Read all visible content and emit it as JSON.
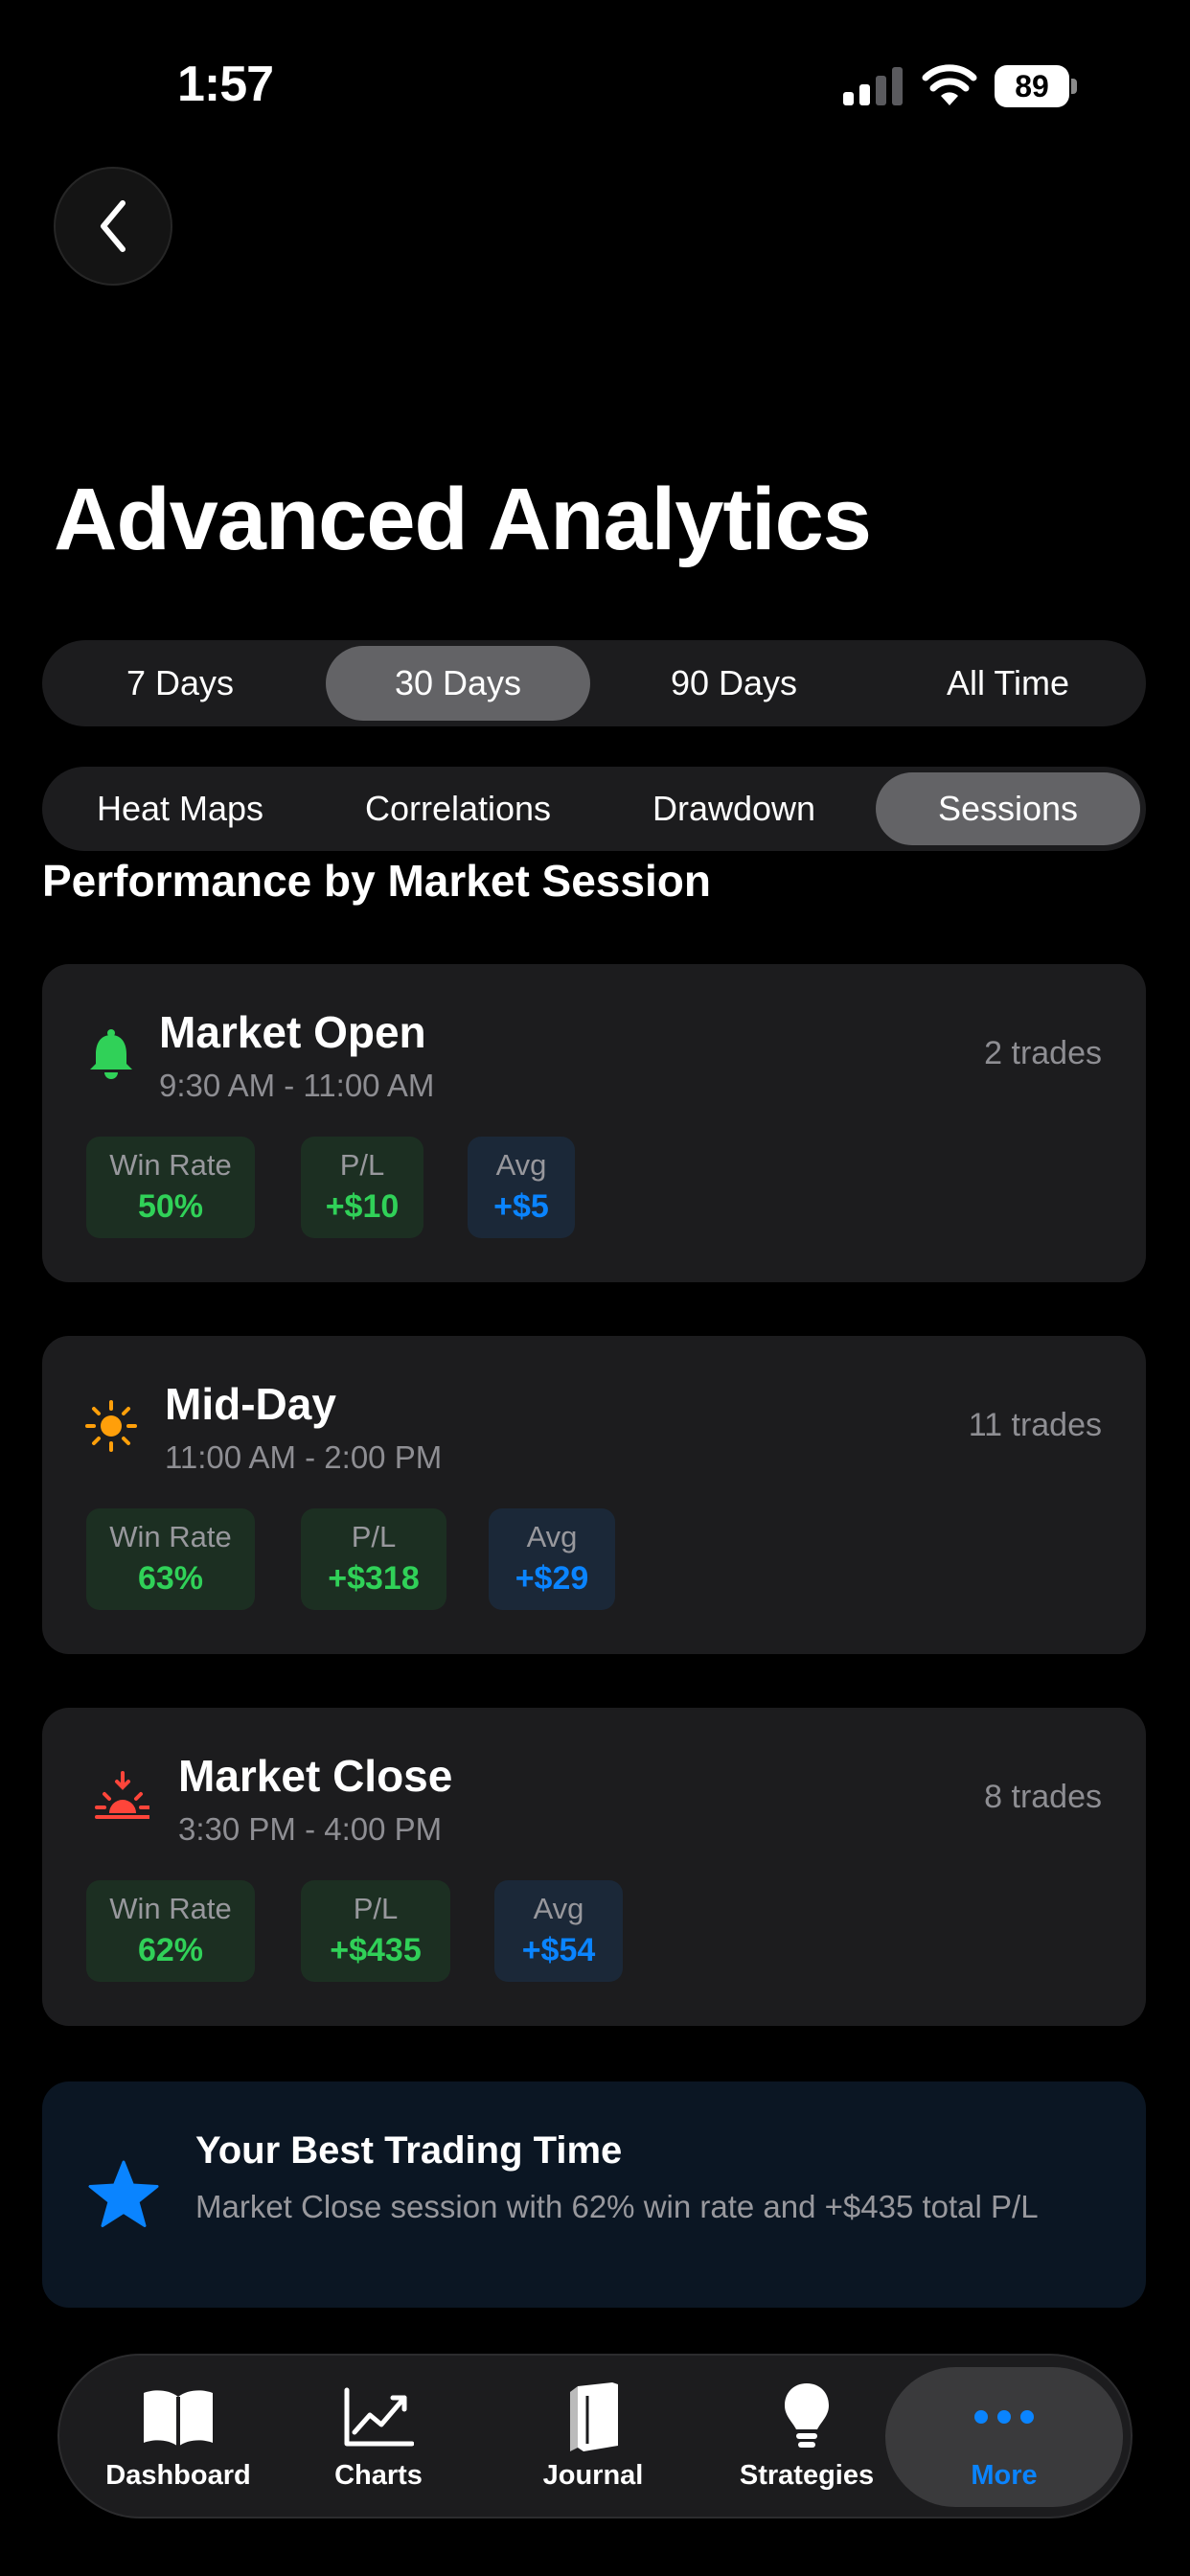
{
  "status": {
    "time": "1:57",
    "battery": "89"
  },
  "header": {
    "title": "Advanced Analytics"
  },
  "range_tabs": [
    {
      "label": "7 Days"
    },
    {
      "label": "30 Days"
    },
    {
      "label": "90 Days"
    },
    {
      "label": "All Time"
    }
  ],
  "range_selected": "30 Days",
  "view_tabs": [
    {
      "label": "Heat Maps"
    },
    {
      "label": "Correlations"
    },
    {
      "label": "Drawdown"
    },
    {
      "label": "Sessions"
    }
  ],
  "view_selected": "Sessions",
  "section_title": "Performance by Market Session",
  "sessions": [
    {
      "name": "Market Open",
      "hours": "9:30 AM - 11:00 AM",
      "trades": "2 trades",
      "icon": "bell-icon",
      "win_rate_label": "Win Rate",
      "win_rate": "50%",
      "pl_label": "P/L",
      "pl": "+$10",
      "avg_label": "Avg",
      "avg": "+$5"
    },
    {
      "name": "Mid-Day",
      "hours": "11:00 AM - 2:00 PM",
      "trades": "11 trades",
      "icon": "sun-icon",
      "win_rate_label": "Win Rate",
      "win_rate": "63%",
      "pl_label": "P/L",
      "pl": "+$318",
      "avg_label": "Avg",
      "avg": "+$29"
    },
    {
      "name": "Market Close",
      "hours": "3:30 PM - 4:00 PM",
      "trades": "8 trades",
      "icon": "sunset-icon",
      "win_rate_label": "Win Rate",
      "win_rate": "62%",
      "pl_label": "P/L",
      "pl": "+$435",
      "avg_label": "Avg",
      "avg": "+$54"
    }
  ],
  "best_time": {
    "title": "Your Best Trading Time",
    "description": "Market Close session with 62% win rate and +$435 total P/L",
    "icon": "star-icon"
  },
  "tab_bar": [
    {
      "label": "Dashboard",
      "icon": "book-icon"
    },
    {
      "label": "Charts",
      "icon": "chart-line-icon"
    },
    {
      "label": "Journal",
      "icon": "journal-icon"
    },
    {
      "label": "Strategies",
      "icon": "lightbulb-icon"
    },
    {
      "label": "More",
      "icon": "ellipsis-icon"
    }
  ],
  "tab_selected": "More",
  "colors": {
    "background": "#000000",
    "card": "#1c1c1e",
    "positive": "#30d158",
    "accent": "#0a84ff",
    "bell": "#30d158",
    "sun": "#ff9f0a",
    "sunset": "#ff453a"
  }
}
